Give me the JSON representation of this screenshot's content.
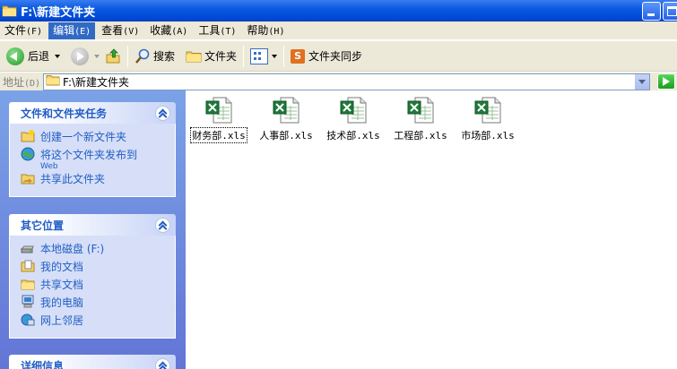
{
  "window": {
    "title": "F:\\新建文件夹"
  },
  "menubar": {
    "items": [
      {
        "label": "文件",
        "accel": "(F)"
      },
      {
        "label": "编辑",
        "accel": "(E)"
      },
      {
        "label": "查看",
        "accel": "(V)"
      },
      {
        "label": "收藏",
        "accel": "(A)"
      },
      {
        "label": "工具",
        "accel": "(T)"
      },
      {
        "label": "帮助",
        "accel": "(H)"
      }
    ]
  },
  "toolbar": {
    "back_label": "后退",
    "search_label": "搜索",
    "folders_label": "文件夹",
    "sync_label": "文件夹同步"
  },
  "addressbar": {
    "label": "地址",
    "accel": "(D)",
    "value": "F:\\新建文件夹"
  },
  "taskpane": {
    "file_tasks": {
      "title": "文件和文件夹任务",
      "items": [
        {
          "label": "创建一个新文件夹"
        },
        {
          "label": "将这个文件夹发布到",
          "sub": "Web"
        },
        {
          "label": "共享此文件夹"
        }
      ]
    },
    "other_places": {
      "title": "其它位置",
      "items": [
        {
          "label": "本地磁盘 (F:)"
        },
        {
          "label": "我的文档"
        },
        {
          "label": "共享文档"
        },
        {
          "label": "我的电脑"
        },
        {
          "label": "网上邻居"
        }
      ]
    },
    "details": {
      "title": "详细信息"
    }
  },
  "files": [
    {
      "name": "财务部.xls"
    },
    {
      "name": "人事部.xls"
    },
    {
      "name": "技术部.xls"
    },
    {
      "name": "工程部.xls"
    },
    {
      "name": "市场部.xls"
    }
  ],
  "colors": {
    "titlebar": "#0a5ae0",
    "menu_active": "#316ac5",
    "link": "#215dc6",
    "excel_green": "#1f7a3a"
  }
}
